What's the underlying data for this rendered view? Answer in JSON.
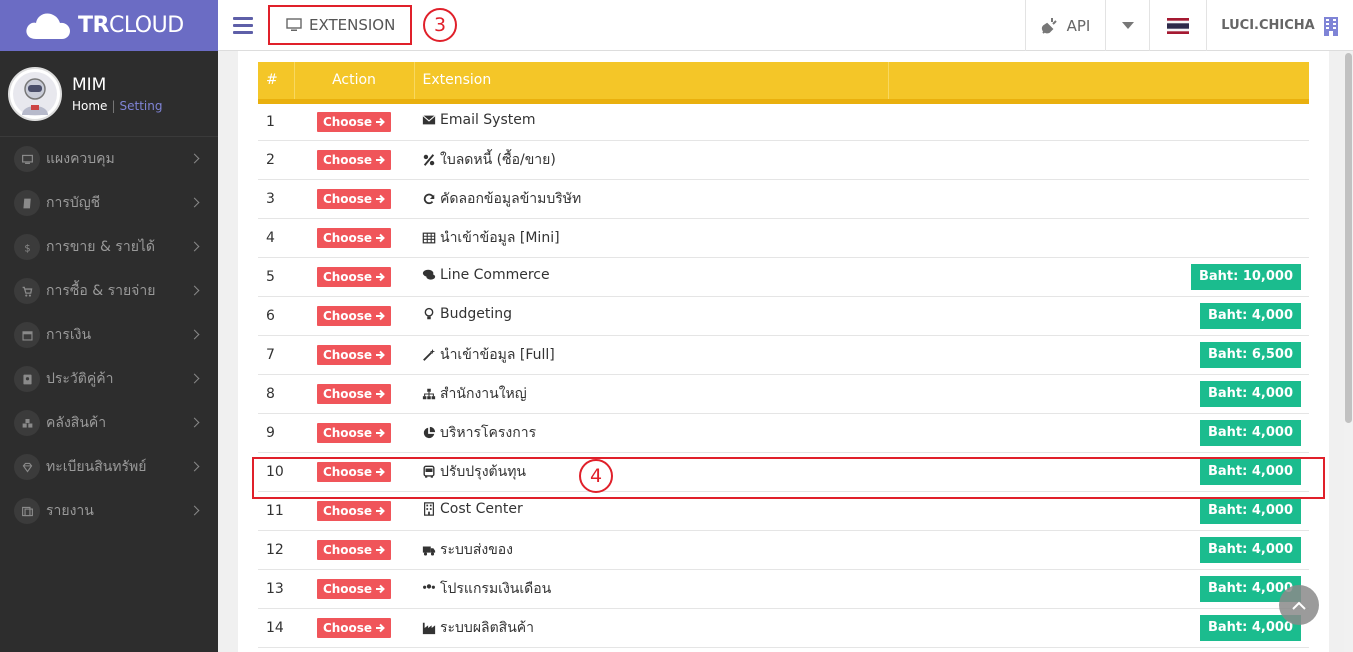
{
  "brand": {
    "bold": "TR",
    "light": "CLOUD"
  },
  "header": {
    "extension_label": "EXTENSION",
    "marker_header": "3",
    "api_label": "API",
    "user_label": "LUCI.CHICHA"
  },
  "profile": {
    "name": "MIM",
    "home": "Home",
    "separator": "|",
    "setting": "Setting"
  },
  "sidebar": {
    "items": [
      {
        "label": "แผงควบคุม",
        "icon": "monitor-icon"
      },
      {
        "label": "การบัญชี",
        "icon": "book-icon"
      },
      {
        "label": "การขาย & รายได้",
        "icon": "dollar-icon"
      },
      {
        "label": "การซื้อ & รายจ่าย",
        "icon": "cart-icon"
      },
      {
        "label": "การเงิน",
        "icon": "calendar-icon"
      },
      {
        "label": "ประวัติคู่ค้า",
        "icon": "contact-book-icon"
      },
      {
        "label": "คลังสินค้า",
        "icon": "cubes-icon"
      },
      {
        "label": "ทะเบียนสินทรัพย์",
        "icon": "diamond-icon"
      },
      {
        "label": "รายงาน",
        "icon": "report-icon"
      }
    ]
  },
  "table": {
    "headers": {
      "num": "#",
      "action": "Action",
      "extension": "Extension"
    },
    "choose_label": "Choose",
    "rows": [
      {
        "num": "1",
        "name": "Email System",
        "icon": "envelope-icon",
        "price": ""
      },
      {
        "num": "2",
        "name": "ใบลดหนี้ (ซื้อ/ขาย)",
        "icon": "percent-icon",
        "price": ""
      },
      {
        "num": "3",
        "name": "คัดลอกข้อมูลข้ามบริษัท",
        "icon": "refresh-icon",
        "price": ""
      },
      {
        "num": "4",
        "name": "นำเข้าข้อมูล [Mini]",
        "icon": "table-icon",
        "price": ""
      },
      {
        "num": "5",
        "name": "Line Commerce",
        "icon": "chat-icon",
        "price": "Baht: 10,000"
      },
      {
        "num": "6",
        "name": "Budgeting",
        "icon": "lightbulb-icon",
        "price": "Baht: 4,000"
      },
      {
        "num": "7",
        "name": "นำเข้าข้อมูล [Full]",
        "icon": "magic-wand-icon",
        "price": "Baht: 6,500"
      },
      {
        "num": "8",
        "name": "สำนักงานใหญ่",
        "icon": "sitemap-icon",
        "price": "Baht: 4,000"
      },
      {
        "num": "9",
        "name": "บริหารโครงการ",
        "icon": "pie-chart-icon",
        "price": "Baht: 4,000"
      },
      {
        "num": "10",
        "name": "ปรับปรุงต้นทุน",
        "icon": "bus-icon",
        "price": "Baht: 4,000"
      },
      {
        "num": "11",
        "name": "Cost Center",
        "icon": "building-icon",
        "price": "Baht: 4,000"
      },
      {
        "num": "12",
        "name": "ระบบส่งของ",
        "icon": "truck-icon",
        "price": "Baht: 4,000"
      },
      {
        "num": "13",
        "name": "โปรแกรมเงินเดือน",
        "icon": "users-icon",
        "price": "Baht: 4,000"
      },
      {
        "num": "14",
        "name": "ระบบผลิตสินค้า",
        "icon": "factory-icon",
        "price": "Baht: 4,000"
      }
    ],
    "marker_row": "4"
  },
  "colors": {
    "brand": "#6b6cc4",
    "header_row": "#f4c628",
    "choose": "#f0555a",
    "price": "#1bbc8e",
    "annotation": "#e0202a"
  }
}
